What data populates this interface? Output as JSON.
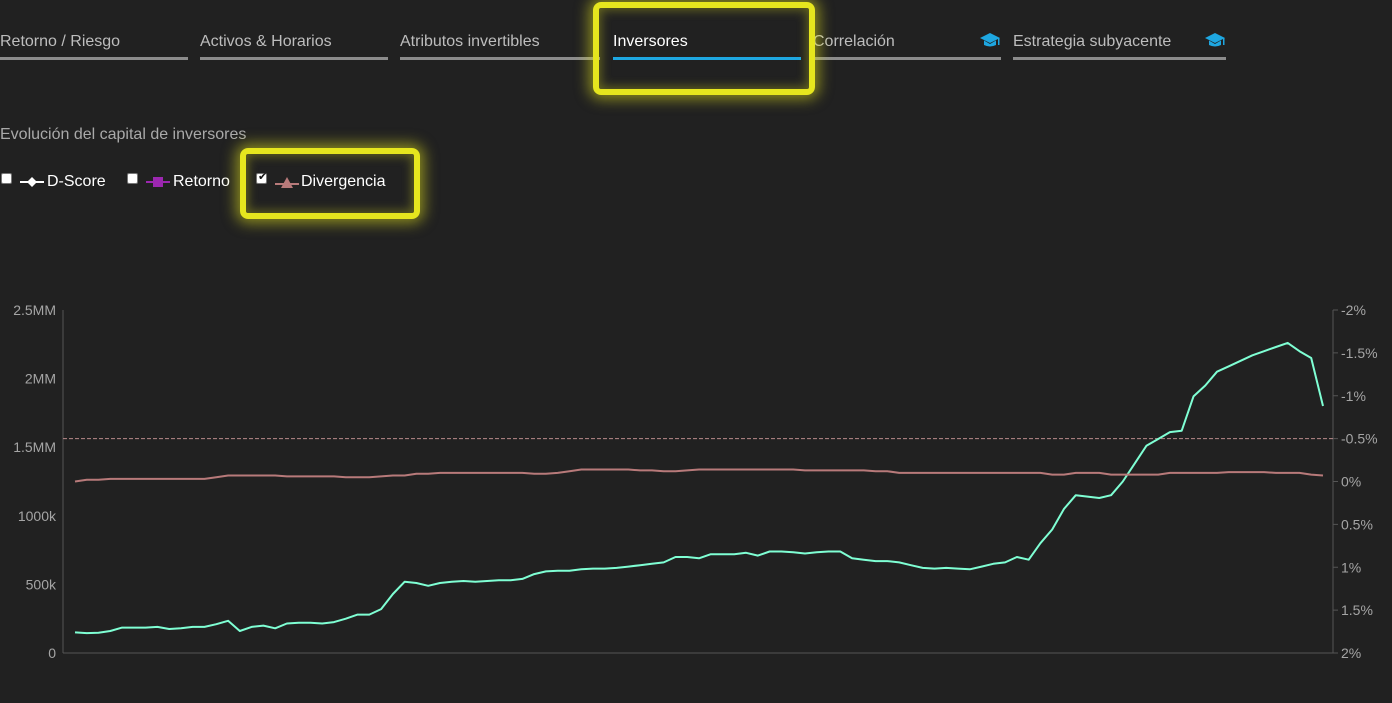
{
  "tabs": [
    {
      "label": "Retorno / Riesgo"
    },
    {
      "label": "Activos & Horarios"
    },
    {
      "label": "Atributos invertibles"
    },
    {
      "label": "Inversores"
    },
    {
      "label": "Correlación",
      "icon": "graduation-cap-icon"
    },
    {
      "label": "Estrategia subyacente",
      "icon": "graduation-cap-icon"
    }
  ],
  "active_tab": "Inversores",
  "accent_color": "#1ea7e1",
  "highlight_color": "#e6e61e",
  "subtitle": "Evolución del capital de inversores",
  "legend": [
    {
      "label": "D-Score",
      "checked": false,
      "color": "#ffffff",
      "marker": "diamond"
    },
    {
      "label": "Retorno",
      "checked": false,
      "color": "#9c27b0",
      "marker": "square"
    },
    {
      "label": "Divergencia",
      "checked": true,
      "color": "#b87a7a",
      "marker": "triangle"
    }
  ],
  "chart_data": {
    "type": "line",
    "y_left_ticks": [
      "2.5MM",
      "2MM",
      "1.5MM",
      "1000k",
      "500k",
      "0"
    ],
    "y_right_ticks": [
      "-2%",
      "-1.5%",
      "-1%",
      "-0.5%",
      "0%",
      "0.5%",
      "1%",
      "1.5%",
      "2%"
    ],
    "ylim_left": [
      0,
      2500000
    ],
    "ylim_right": [
      2,
      -2
    ],
    "reference_line_right": -0.5,
    "series": [
      {
        "axis": "left",
        "color": "#7fffd4",
        "values": [
          150000,
          145000,
          148000,
          160000,
          185000,
          185000,
          185000,
          190000,
          175000,
          180000,
          190000,
          190000,
          210000,
          235000,
          160000,
          190000,
          200000,
          180000,
          215000,
          220000,
          220000,
          215000,
          225000,
          250000,
          280000,
          280000,
          320000,
          430000,
          520000,
          510000,
          490000,
          510000,
          520000,
          525000,
          520000,
          525000,
          530000,
          530000,
          540000,
          575000,
          595000,
          600000,
          600000,
          610000,
          615000,
          615000,
          620000,
          630000,
          640000,
          650000,
          660000,
          700000,
          700000,
          690000,
          720000,
          720000,
          720000,
          730000,
          710000,
          740000,
          740000,
          735000,
          725000,
          735000,
          740000,
          740000,
          690000,
          680000,
          670000,
          670000,
          660000,
          640000,
          620000,
          615000,
          620000,
          615000,
          610000,
          630000,
          650000,
          660000,
          700000,
          680000,
          800000,
          900000,
          1050000,
          1150000,
          1140000,
          1130000,
          1150000,
          1250000,
          1380000,
          1510000,
          1560000,
          1610000,
          1620000,
          1870000,
          1950000,
          2050000,
          2090000,
          2130000,
          2170000,
          2200000,
          2230000,
          2260000,
          2200000,
          2150000,
          1800000
        ]
      },
      {
        "axis": "right",
        "color": "#b87a7a",
        "values": [
          0.0,
          -0.02,
          -0.02,
          -0.03,
          -0.03,
          -0.03,
          -0.03,
          -0.03,
          -0.03,
          -0.03,
          -0.03,
          -0.03,
          -0.05,
          -0.07,
          -0.07,
          -0.07,
          -0.07,
          -0.07,
          -0.06,
          -0.06,
          -0.06,
          -0.06,
          -0.06,
          -0.05,
          -0.05,
          -0.05,
          -0.06,
          -0.07,
          -0.07,
          -0.09,
          -0.09,
          -0.1,
          -0.1,
          -0.1,
          -0.1,
          -0.1,
          -0.1,
          -0.1,
          -0.1,
          -0.09,
          -0.09,
          -0.1,
          -0.12,
          -0.14,
          -0.14,
          -0.14,
          -0.14,
          -0.14,
          -0.13,
          -0.13,
          -0.12,
          -0.12,
          -0.13,
          -0.14,
          -0.14,
          -0.14,
          -0.14,
          -0.14,
          -0.14,
          -0.14,
          -0.14,
          -0.14,
          -0.13,
          -0.13,
          -0.13,
          -0.13,
          -0.13,
          -0.13,
          -0.12,
          -0.12,
          -0.1,
          -0.1,
          -0.1,
          -0.1,
          -0.1,
          -0.1,
          -0.1,
          -0.1,
          -0.1,
          -0.1,
          -0.1,
          -0.1,
          -0.1,
          -0.08,
          -0.08,
          -0.1,
          -0.1,
          -0.1,
          -0.08,
          -0.08,
          -0.08,
          -0.08,
          -0.08,
          -0.1,
          -0.1,
          -0.1,
          -0.1,
          -0.1,
          -0.11,
          -0.11,
          -0.11,
          -0.11,
          -0.1,
          -0.1,
          -0.1,
          -0.08,
          -0.07
        ]
      }
    ]
  }
}
